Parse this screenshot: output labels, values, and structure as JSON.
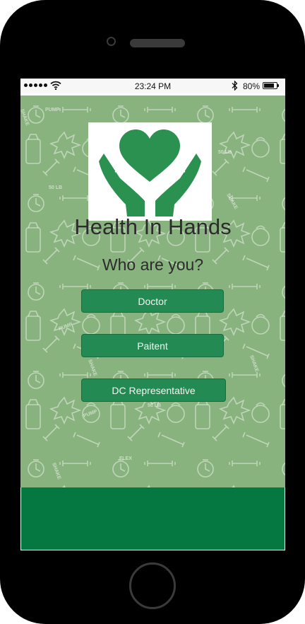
{
  "status_bar": {
    "time": "23:24 PM",
    "battery": "80%"
  },
  "app": {
    "title": "Health In Hands"
  },
  "prompt": {
    "question": "Who are you?"
  },
  "roles": {
    "doctor": "Doctor",
    "patient": "Paitent",
    "dc_rep": "DC Representative"
  },
  "pattern_words": [
    "SHAKE",
    "PUMP",
    "50 LB",
    "FLEX"
  ],
  "colors": {
    "background_pattern": "#89b37e",
    "button": "#238a54",
    "footer": "#057741",
    "logo_green": "#1f8a43"
  },
  "icons": [
    "signal-icon",
    "wifi-icon",
    "bluetooth-icon",
    "battery-icon",
    "heart-hands-logo-icon"
  ]
}
